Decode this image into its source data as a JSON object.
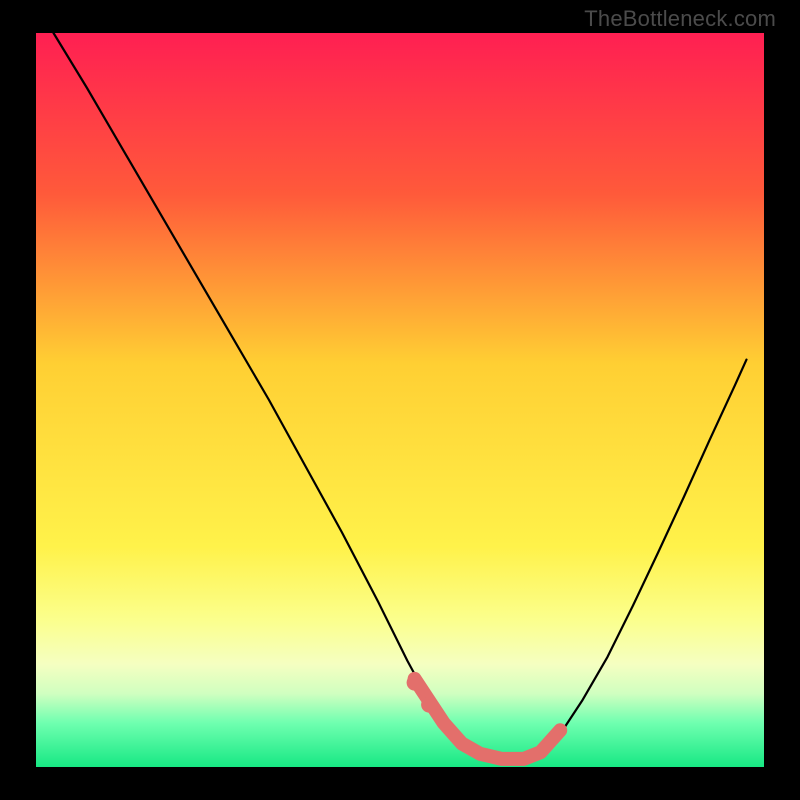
{
  "watermark": {
    "url_text": "TheBottleneck.com"
  },
  "chart_data": {
    "type": "line",
    "title": "",
    "xlabel": "",
    "ylabel": "",
    "xlim": [
      0,
      100
    ],
    "ylim": [
      0,
      100
    ],
    "grid": false,
    "legend": false,
    "series": [
      {
        "name": "main-curve",
        "color": "#000000",
        "x": [
          2.4,
          7.0,
          12.0,
          17.0,
          22.0,
          27.0,
          32.0,
          37.0,
          42.0,
          47.0,
          51.0,
          54.0,
          56.5,
          58.5,
          61.0,
          64.0,
          67.0,
          69.3,
          72.0,
          75.0,
          78.5,
          82.0,
          85.5,
          89.0,
          92.5,
          96.0,
          97.6
        ],
        "y": [
          100.0,
          92.5,
          84.0,
          75.5,
          67.0,
          58.5,
          50.0,
          41.0,
          32.0,
          22.5,
          14.5,
          9.0,
          5.5,
          3.2,
          1.8,
          1.1,
          1.1,
          2.0,
          4.5,
          9.0,
          15.0,
          22.0,
          29.3,
          36.8,
          44.5,
          52.0,
          55.5
        ]
      },
      {
        "name": "highlight-band",
        "color": "#e36f6b",
        "x": [
          52.0,
          54.0,
          56.0,
          58.5,
          61.0,
          64.0,
          67.0,
          69.3,
          72.0
        ],
        "y": [
          12.0,
          9.0,
          6.0,
          3.2,
          1.8,
          1.1,
          1.1,
          2.0,
          5.0
        ]
      }
    ],
    "highlight_dots": {
      "color": "#e36f6b",
      "x": [
        52.0,
        54.0
      ],
      "y": [
        11.5,
        8.5
      ]
    },
    "background_gradient_stops": [
      {
        "offset": 0.0,
        "color": "#ff1f52"
      },
      {
        "offset": 0.22,
        "color": "#ff5a3a"
      },
      {
        "offset": 0.45,
        "color": "#ffcf33"
      },
      {
        "offset": 0.7,
        "color": "#fff24a"
      },
      {
        "offset": 0.8,
        "color": "#fbff8d"
      },
      {
        "offset": 0.86,
        "color": "#f5ffc1"
      },
      {
        "offset": 0.9,
        "color": "#d0ffc0"
      },
      {
        "offset": 0.94,
        "color": "#6fffb0"
      },
      {
        "offset": 1.0,
        "color": "#17e884"
      }
    ]
  },
  "plot_geometry": {
    "outer_w": 800,
    "outer_h": 800,
    "inner_x": 36,
    "inner_y": 33,
    "inner_w": 728,
    "inner_h": 734
  }
}
